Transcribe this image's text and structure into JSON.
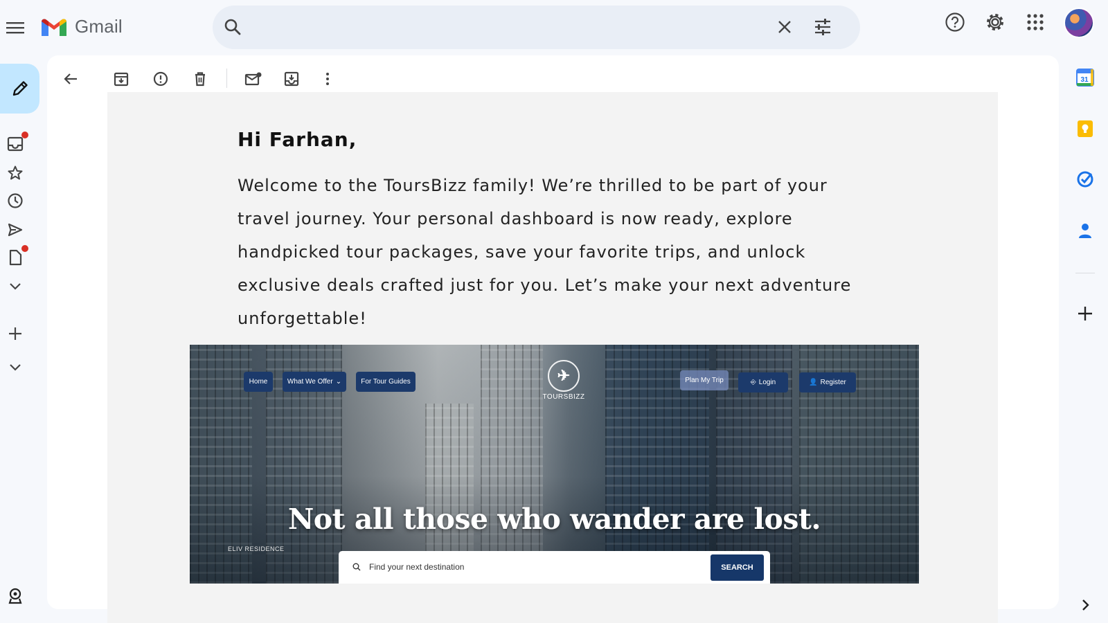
{
  "app": {
    "name": "Gmail"
  },
  "search": {
    "value": "",
    "placeholder": ""
  },
  "toolbar": {
    "back": "Back",
    "archive": "Archive",
    "spam": "Report spam",
    "delete": "Delete",
    "mark_unread": "Mark as unread",
    "move": "Move to",
    "more": "More"
  },
  "email": {
    "greeting": "Hi Farhan,",
    "body": "Welcome to the ToursBizz family! We’re thrilled to be part of your travel journey. Your personal dashboard is now ready, explore handpicked tour packages, save your favorite trips, and unlock exclusive deals crafted just for you. Let’s make your next adventure unforgettable!",
    "banner": {
      "nav": [
        "Home",
        "What We Offer",
        "For Tour Guides"
      ],
      "nav_right": [
        "Plan My Trip",
        "Login",
        "Register"
      ],
      "logo_text": "TOURSBIZZ",
      "headline": "Not all those who wander are lost.",
      "search_placeholder": "Find your next destination",
      "search_button": "SEARCH",
      "building_sign": "ELIV RESIDENCE"
    }
  },
  "colors": {
    "compose_bg": "#c2e7ff",
    "unread_dot": "#d93025",
    "banner_nav": "#1c3a6b"
  },
  "icons": {
    "top": [
      "menu-icon",
      "search-icon",
      "close-icon",
      "tune-icon",
      "help-icon",
      "settings-icon",
      "apps-icon"
    ],
    "nav": [
      "inbox-icon",
      "star-icon",
      "clock-icon",
      "send-icon",
      "draft-icon",
      "chevron-down-icon",
      "plus-icon",
      "chevron-down-icon"
    ],
    "side": [
      "calendar-icon",
      "keep-icon",
      "tasks-icon",
      "contacts-icon",
      "plus-icon",
      "chevron-right-icon"
    ]
  }
}
